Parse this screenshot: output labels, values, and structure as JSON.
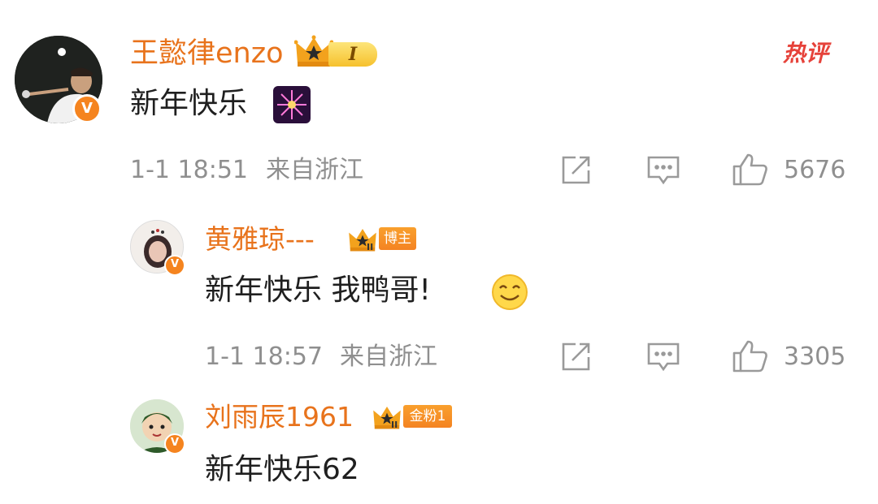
{
  "hot_label": "热评",
  "comment": {
    "username": "王懿律enzo",
    "level": "I",
    "text": "新年快乐",
    "emoji_icon": "fireworks-icon",
    "time": "1-1 18:51",
    "location": "来自浙江",
    "likes": "5676"
  },
  "replies": [
    {
      "username": "黄雅琼---",
      "level": "II",
      "tag": "博主",
      "text": "新年快乐 我鸭哥!",
      "emoji_icon": "smile-emoji-icon",
      "time": "1-1 18:57",
      "location": "来自浙江",
      "likes": "3305"
    },
    {
      "username": "刘雨辰1961",
      "level": "II",
      "tag": "金粉1",
      "text": "新年快乐62"
    }
  ],
  "colors": {
    "username": "#e8731c",
    "badge": "#f5841f",
    "hot": "#e6423a",
    "meta": "#8f8f8f"
  }
}
